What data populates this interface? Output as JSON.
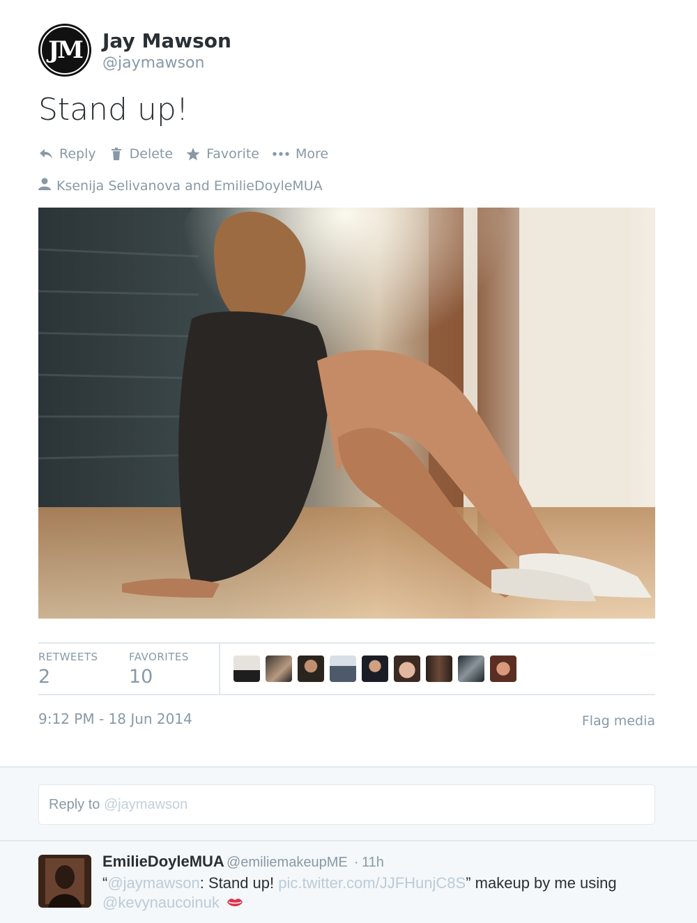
{
  "tweet": {
    "avatar_monogram": "JM",
    "fullname": "Jay Mawson",
    "username": "@jaymawson",
    "text": "Stand up!",
    "actions": [
      {
        "icon": "reply-icon",
        "label": "Reply"
      },
      {
        "icon": "trash-icon",
        "label": "Delete"
      },
      {
        "icon": "star-icon",
        "label": "Favorite"
      },
      {
        "icon": "more-dots-icon",
        "label": "More"
      }
    ],
    "tagged_people": "Ksenija Selivanova and EmilieDoyleMUA",
    "stats": {
      "retweets_label": "RETWEETS",
      "retweets_value": "2",
      "favorites_label": "FAVORITES",
      "favorites_value": "10"
    },
    "favoriter_avatars": 9,
    "timestamp": "9:12 PM - 18 Jun 2014",
    "flag_label": "Flag media"
  },
  "reply_box": {
    "prefix": "Reply to",
    "handle": "@jaymawson"
  },
  "reply_tweet": {
    "fullname": "EmilieDoyleMUA",
    "username": "@emiliemakeupME",
    "separator": "·",
    "time": "11h",
    "quote_open": "“",
    "mention": "@jaymawson",
    "text_1": ": Stand up! ",
    "link": "pic.twitter.com/JJFHunjC8S",
    "text_2": "” makeup by me using",
    "mention_2": "@kevynaucoinuk",
    "emoji_icon": "lips-icon"
  },
  "colors": {
    "text_primary": "#292f33",
    "text_muted": "#8899a6",
    "divider": "#e1e8ed",
    "background_alt": "#f5f8fa"
  }
}
